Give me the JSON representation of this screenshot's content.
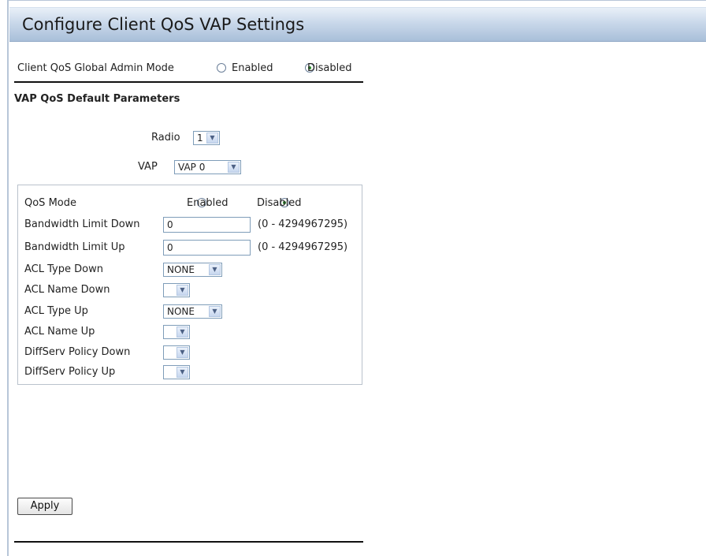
{
  "page_title": "Configure Client QoS VAP Settings",
  "global_mode": {
    "label": "Client QoS Global Admin Mode",
    "enabled_label": "Enabled",
    "disabled_label": "Disabled",
    "selected": "Disabled"
  },
  "section_title": "VAP QoS Default Parameters",
  "radio_select": {
    "label": "Radio",
    "value": "1"
  },
  "vap_select": {
    "label": "VAP",
    "value": "VAP 0"
  },
  "qos_mode": {
    "label": "QoS Mode",
    "enabled_label": "Enabled",
    "disabled_label": "Disabled",
    "selected": "Disabled"
  },
  "bw_down": {
    "label": "Bandwidth Limit Down",
    "value": "0",
    "range": "(0 - 4294967295)"
  },
  "bw_up": {
    "label": "Bandwidth Limit Up",
    "value": "0",
    "range": "(0 - 4294967295)"
  },
  "acl_type_down": {
    "label": "ACL Type Down",
    "value": "NONE"
  },
  "acl_name_down": {
    "label": "ACL Name Down",
    "value": ""
  },
  "acl_type_up": {
    "label": "ACL Type Up",
    "value": "NONE"
  },
  "acl_name_up": {
    "label": "ACL Name Up",
    "value": ""
  },
  "diffserv_down": {
    "label": "DiffServ Policy Down",
    "value": ""
  },
  "diffserv_up": {
    "label": "DiffServ Policy Up",
    "value": ""
  },
  "apply_label": "Apply",
  "colors": {
    "banner_top": "#e9f0f8",
    "banner_bottom": "#a9bfd9",
    "radio_checked": "#2e8b2e"
  }
}
